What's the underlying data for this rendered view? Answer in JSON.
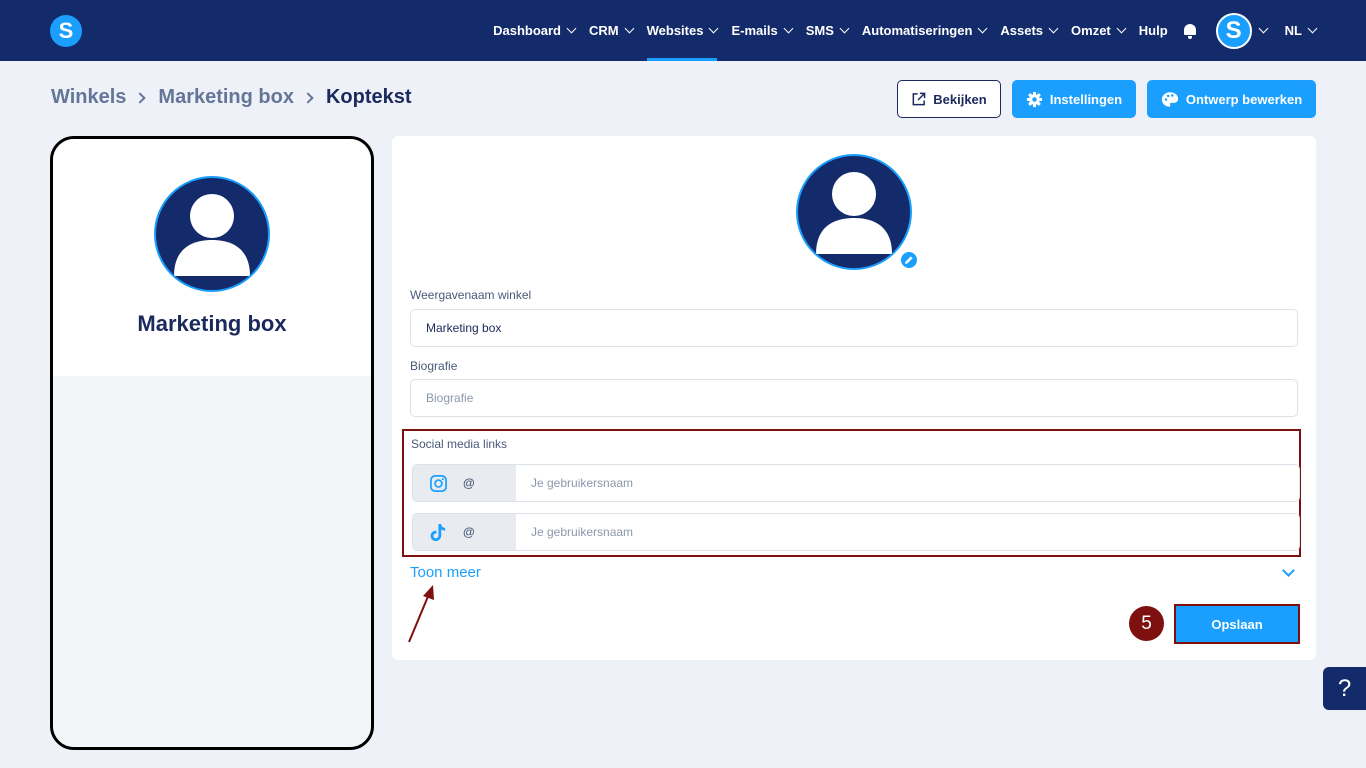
{
  "nav": {
    "logo": "S",
    "items": [
      {
        "label": "Dashboard"
      },
      {
        "label": "CRM"
      },
      {
        "label": "Websites"
      },
      {
        "label": "E-mails"
      },
      {
        "label": "SMS"
      },
      {
        "label": "Automatiseringen"
      },
      {
        "label": "Assets"
      },
      {
        "label": "Omzet"
      }
    ],
    "active_item": "Websites",
    "help": "Hulp",
    "avatar": "S",
    "language": "NL"
  },
  "breadcrumb": {
    "items": [
      "Winkels",
      "Marketing box"
    ],
    "current": "Koptekst"
  },
  "actions": {
    "view": "Bekijken",
    "settings": "Instellingen",
    "design": "Ontwerp bewerken"
  },
  "preview": {
    "shop_name": "Marketing box"
  },
  "form": {
    "display_name_label": "Weergavenaam winkel",
    "display_name_value": "Marketing box",
    "bio_label": "Biografie",
    "bio_placeholder": "Biografie",
    "social_label": "Social media links",
    "social": [
      {
        "icon": "instagram-icon",
        "prefix": "@",
        "placeholder": "Je gebruikersnaam"
      },
      {
        "icon": "tiktok-icon",
        "prefix": "@",
        "placeholder": "Je gebruikersnaam"
      }
    ],
    "show_more": "Toon meer",
    "save": "Opslaan"
  },
  "annotation": {
    "step_number": "5",
    "color": "#7e1010"
  },
  "help_button": "?",
  "colors": {
    "navy": "#142b6b",
    "accent": "#1a9fff",
    "background": "#eef2f8"
  }
}
